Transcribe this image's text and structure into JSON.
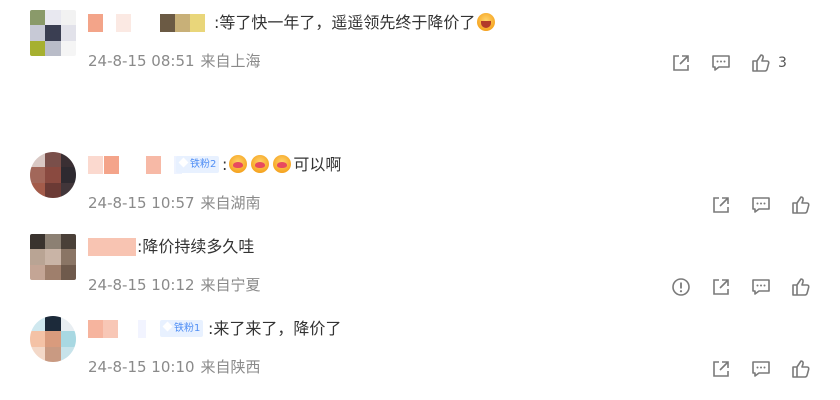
{
  "comments": [
    {
      "text": ":等了快一年了，遥遥领先终于降价了",
      "time": "24-8-15 08:51",
      "location": "来自上海",
      "like_count": "3",
      "emoji": "laughing-crying-emoji"
    },
    {
      "badge": "铁粉2",
      "text_prefix": ":",
      "text": "可以啊",
      "time": "24-8-15 10:57",
      "location": "来自湖南",
      "emoji": "kiss-emoji"
    },
    {
      "text": ":降价持续多久哇",
      "time": "24-8-15 10:12",
      "location": "来自宁夏"
    },
    {
      "badge": "铁粉1",
      "text": ":来了来了，降价了",
      "time": "24-8-15 10:10",
      "location": "来自陕西"
    }
  ],
  "icons": {
    "share": "share-icon",
    "comment": "comment-icon",
    "like": "thumbs-up-icon",
    "report": "report-icon"
  },
  "colors": {
    "text": "#333333",
    "meta": "#8a8a8a",
    "icon": "#7a7a7a",
    "badge_bg": "#e8f1ff",
    "badge_text": "#4f8ef5"
  }
}
